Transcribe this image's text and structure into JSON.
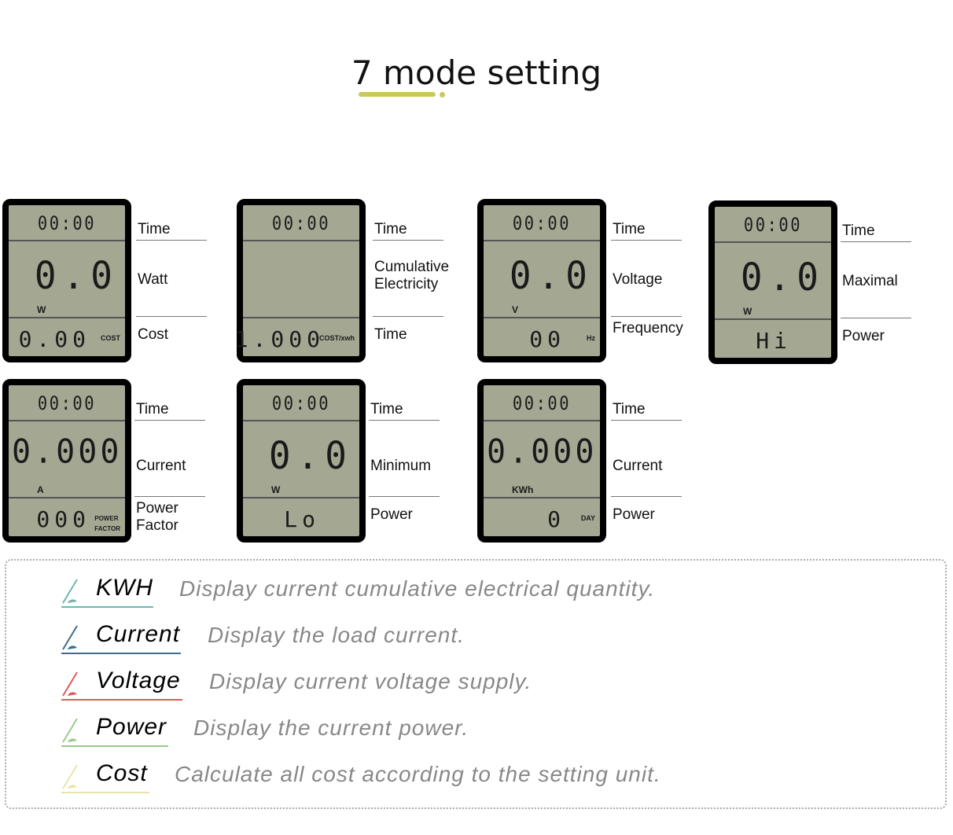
{
  "title": "7 mode setting",
  "accent": "#c9c95a",
  "panels": [
    {
      "time": "00:00",
      "main": "0.0",
      "unit": "W",
      "bottom": "0.00",
      "tag": "COST",
      "labels": [
        "Time",
        "Watt",
        "Cost"
      ]
    },
    {
      "time": "00:00",
      "main": "",
      "unit": "",
      "bottom": "1.000",
      "tag": "COST/xwh",
      "labels": [
        "Time",
        "Cumulative Electricity",
        "Time"
      ]
    },
    {
      "time": "00:00",
      "main": "0.0",
      "unit": "V",
      "bottom": "00",
      "tag": "Hz",
      "labels": [
        "Time",
        "Voltage",
        "Frequency"
      ]
    },
    {
      "time": "00:00",
      "main": "0.0",
      "unit": "W",
      "bottom": "Hi",
      "tag": "",
      "labels": [
        "Time",
        "Maximal",
        "Power"
      ]
    },
    {
      "time": "00:00",
      "main": "0.000",
      "unit": "A",
      "bottom": "000",
      "tag": "POWER FACTOR",
      "labels": [
        "Time",
        "Current",
        "Power Factor"
      ]
    },
    {
      "time": "00:00",
      "main": "0.0",
      "unit": "W",
      "bottom": "Lo",
      "tag": "",
      "labels": [
        "Time",
        "Minimum",
        "Power"
      ]
    },
    {
      "time": "00:00",
      "main": "0.000",
      "unit": "KWh",
      "bottom": "0",
      "tag": "DAY",
      "labels": [
        "Time",
        "Current",
        "Power"
      ]
    }
  ],
  "legend": [
    {
      "key": "KWH",
      "desc": "Display current cumulative electrical quantity.",
      "color": "#6bb8ad"
    },
    {
      "key": "Current",
      "desc": "Display the load current.",
      "color": "#3b6d8c"
    },
    {
      "key": "Voltage",
      "desc": "Display current voltage supply.",
      "color": "#dd5a5a"
    },
    {
      "key": "Power",
      "desc": "Display the current power.",
      "color": "#9bc98a"
    },
    {
      "key": "Cost",
      "desc": "Calculate all cost according to the setting unit.",
      "color": "#ece3a8"
    }
  ]
}
